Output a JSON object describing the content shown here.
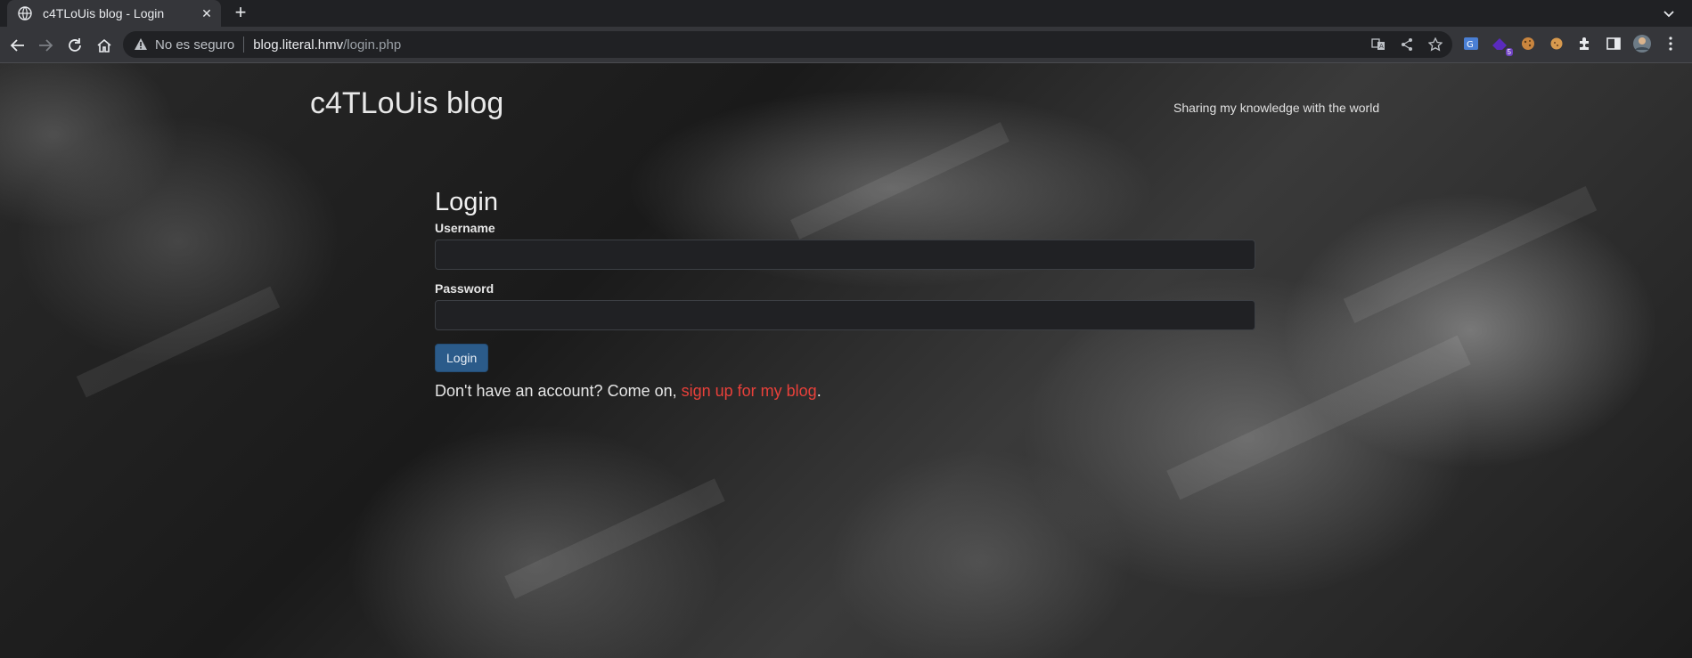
{
  "browser": {
    "tab_title": "c4TLoUis blog - Login",
    "tab_close_glyph": "✕",
    "new_tab_glyph": "+",
    "security_label": "No es seguro",
    "url_host": "blog.literal.hmv",
    "url_path": "/login.php",
    "extension_badge": "5",
    "icons": [
      "back-icon",
      "forward-icon",
      "reload-icon",
      "home-icon",
      "warning-icon",
      "translate-icon",
      "share-icon",
      "star-icon",
      "extensions-icon",
      "side-panel-icon",
      "profile-avatar",
      "menu-icon"
    ]
  },
  "site": {
    "title": "c4TLoUis blog",
    "tagline": "Sharing my knowledge with the world"
  },
  "login": {
    "heading": "Login",
    "username_label": "Username",
    "username_value": "",
    "password_label": "Password",
    "password_value": "",
    "button_label": "Login",
    "signup_prefix": "Don't have an account? Come on, ",
    "signup_link": "sign up for my blog",
    "signup_suffix": "."
  },
  "colors": {
    "link": "#e8403a",
    "button": "#2b5b8a",
    "chrome_dark": "#202124",
    "chrome_toolbar": "#35363a"
  }
}
